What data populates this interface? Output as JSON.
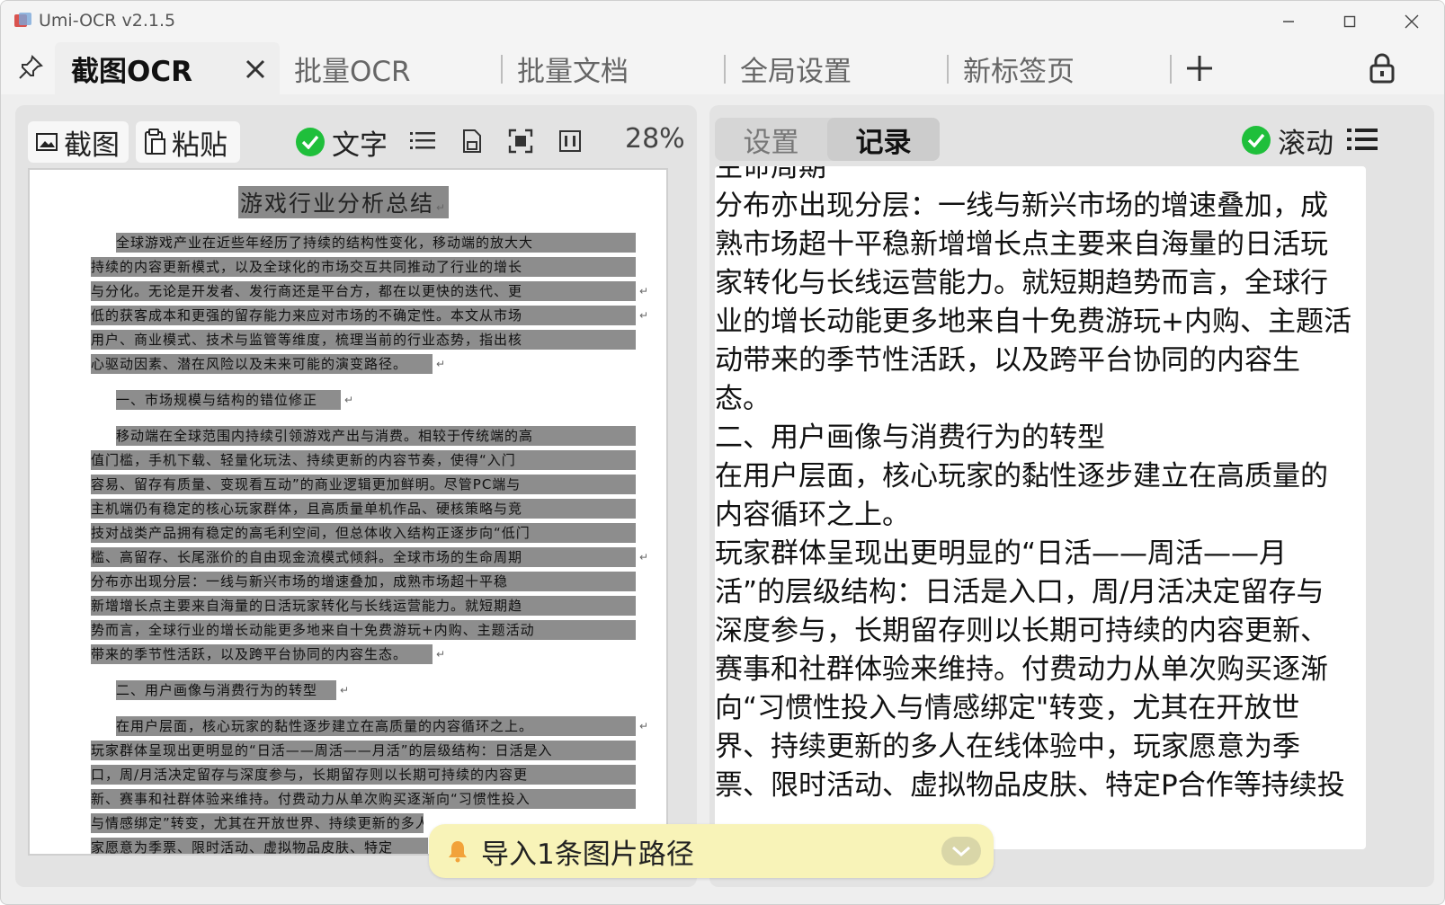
{
  "app": {
    "title": "Umi-OCR v2.1.5"
  },
  "tabs": [
    {
      "label": "截图OCR",
      "active": true
    },
    {
      "label": "批量OCR"
    },
    {
      "label": "批量文档"
    },
    {
      "label": "全局设置"
    },
    {
      "label": "新标签页"
    }
  ],
  "toolbar": {
    "screenshot_label": "截图",
    "paste_label": "粘贴",
    "text_toggle_label": "文字",
    "zoom": "28%"
  },
  "preview": {
    "title": "游戏行业分析总结",
    "lines": [
      "全球游戏产业在近些年经历了持续的结构性变化，移动端的放大大",
      "持续的内容更新模式，以及全球化的市场交互共同推动了行业的增长",
      "与分化。无论是开发者、发行商还是平台方，都在以更快的迭代、更",
      "低的获客成本和更强的留存能力来应对市场的不确定性。本文从市场",
      "用户、商业模式、技术与监管等维度，梳理当前的行业态势，指出核",
      "心驱动因素、潜在风险以及未来可能的演变路径。",
      "一、市场规模与结构的错位修正",
      "移动端在全球范围内持续引领游戏产出与消费。相较于传统端的高",
      "值门槛，手机下载、轻量化玩法、持续更新的内容节奏，使得“入门",
      "容易、留存有质量、变现看互动”的商业逻辑更加鲜明。尽管PC端与",
      "主机端仍有稳定的核心玩家群体，且高质量单机作品、硬核策略与竞",
      "技对战类产品拥有稳定的高毛利空间，但总体收入结构正逐步向“低门",
      "槛、高留存、长尾涨价的自由现金流模式倾斜。全球市场的生命周期",
      "分布亦出现分层：一线与新兴市场的增速叠加，成熟市场超十平稳",
      "新增增长点主要来自海量的日活玩家转化与长线运营能力。就短期趋",
      "势而言，全球行业的增长动能更多地来自十免费游玩+内购、主题活动",
      "带来的季节性活跃，以及跨平台协同的内容生态。",
      "二、用户画像与消费行为的转型",
      "在用户层面，核心玩家的黏性逐步建立在高质量的内容循环之上。",
      "玩家群体呈现出更明显的“日活——周活——月活”的层级结构：日活是入",
      "口，周/月活决定留存与深度参与，长期留存则以长期可持续的内容更",
      "新、赛事和社群体验来维持。付费动力从单次购买逐渐向“习惯性投入",
      "与情感绑定”转变，尤其在开放世界、持续更新的多人在线",
      "家愿意为季票、限时活动、虚拟物品皮肤、特定"
    ]
  },
  "result_panel": {
    "tabs": [
      {
        "label": "设置"
      },
      {
        "label": "记录",
        "active": true
      }
    ],
    "scroll_label": "滚动",
    "text_lines": [
      "生命周期",
      "分布亦出现分层：一线与新兴市场的增速叠加，成",
      "熟市场超十平稳新增增长点主要来自海量的日活玩",
      "家转化与长线运营能力。就短期趋势而言，全球行",
      "业的增长动能更多地来自十免费游玩+内购、主题活",
      "动带来的季节性活跃，以及跨平台协同的内容生",
      "态。",
      "二、用户画像与消费行为的转型",
      "在用户层面，核心玩家的黏性逐步建立在高质量的",
      "内容循环之上。",
      "玩家群体呈现出更明显的“日活——周活——月",
      "活”的层级结构：日活是入口，周/月活决定留存与",
      "深度参与，长期留存则以长期可持续的内容更新、",
      "赛事和社群体验来维持。付费动力从单次购买逐渐",
      "向“习惯性投入与情感绑定\"转变，尤其在开放世",
      "界、持续更新的多人在线体验中，玩家愿意为季",
      "票、限时活动、虚拟物品皮肤、特定P合作等持续投"
    ]
  },
  "toast": {
    "message": "导入1条图片路径"
  },
  "colors": {
    "check_green": "#1fbf3b",
    "toast_bg": "#f8f3b8",
    "bell_orange": "#f2a23a",
    "text_highlight": "#8d8d8d"
  },
  "icons": [
    "app-icon",
    "minimize-icon",
    "maximize-icon",
    "close-icon",
    "pin-icon",
    "tab-close-icon",
    "add-tab-icon",
    "lock-icon",
    "image-icon",
    "paste-icon",
    "check-icon",
    "list-icon",
    "page-icon",
    "focus-icon",
    "columns-icon",
    "menu-icon",
    "bell-icon",
    "chevron-down-icon"
  ]
}
